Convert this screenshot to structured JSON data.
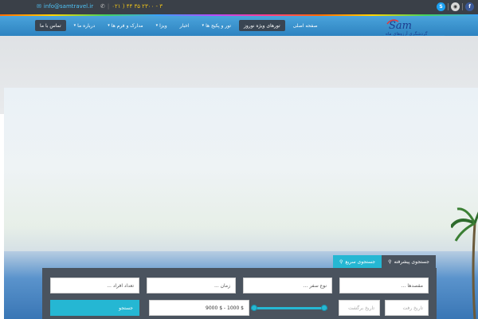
{
  "topbar": {
    "email": "info@samtravel.ir",
    "phone": "۰۲۱ ) ۴۴ ۳۵ ۲۳۰۰ - ۳",
    "social": [
      "skype-icon",
      "rss-icon",
      "facebook-icon"
    ]
  },
  "logo": {
    "brand": "Sam",
    "tagline": "گردشگری آرزوهای ماه"
  },
  "nav": {
    "items": [
      {
        "label": "صفحه اصلی"
      },
      {
        "label": "تورهای ویژه نوروز"
      },
      {
        "label": "تور و پکیج ها"
      },
      {
        "label": "اخبار"
      },
      {
        "label": "ویزا"
      },
      {
        "label": "مدارک و فرم ها"
      },
      {
        "label": "درباره ما"
      },
      {
        "label": "تماس با ما"
      }
    ]
  },
  "search": {
    "tabs": {
      "advanced": "جستجوی پیشرفته",
      "quick": "جستجوی سریع"
    },
    "destinations": "... مقصدها",
    "trip_type": "... نوع سفر",
    "time": "... زمان",
    "people": "... تعداد افراد",
    "depart_date": "تاریخ رفت",
    "return_date": "تاریخ برگشت",
    "price_range": "9000 $ - 1000 $",
    "button": "جستجو"
  },
  "colors": {
    "accent": "#25b7d3",
    "nav": "#3a8fd0",
    "panel": "#4a535e"
  }
}
